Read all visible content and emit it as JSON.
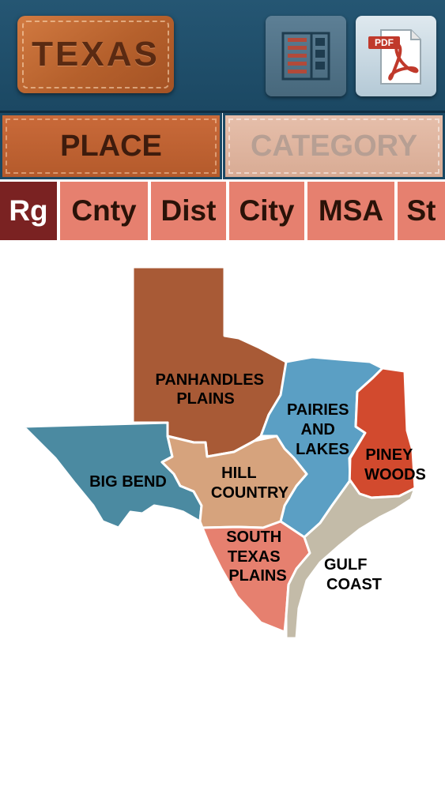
{
  "header": {
    "logo_text": "TEXAS",
    "table_icon": "table-list-icon",
    "pdf_icon": "pdf-document-icon",
    "pdf_label": "PDF"
  },
  "main_tabs": [
    {
      "label": "PLACE",
      "active": true
    },
    {
      "label": "CATEGORY",
      "active": false
    }
  ],
  "sub_tabs": [
    {
      "label": "Rg",
      "active": true
    },
    {
      "label": "Cnty",
      "active": false
    },
    {
      "label": "Dist",
      "active": false
    },
    {
      "label": "City",
      "active": false
    },
    {
      "label": "MSA",
      "active": false
    },
    {
      "label": "St",
      "active": false
    }
  ],
  "map": {
    "regions": [
      {
        "name": "panhandle-plains",
        "lines": [
          "PANHANDLES",
          "PLAINS"
        ],
        "color": "#a85a36"
      },
      {
        "name": "prairies-lakes",
        "lines": [
          "PAIRIES",
          "AND",
          "LAKES"
        ],
        "color": "#5b9fc4"
      },
      {
        "name": "piney-woods",
        "lines": [
          "PINEY",
          "WOODS"
        ],
        "color": "#d24a2e"
      },
      {
        "name": "big-bend",
        "lines": [
          "BIG BEND"
        ],
        "color": "#4b8aa1"
      },
      {
        "name": "hill-country",
        "lines": [
          "HILL",
          "COUNTRY"
        ],
        "color": "#d6a37d"
      },
      {
        "name": "south-texas-plains",
        "lines": [
          "SOUTH",
          "TEXAS",
          "PLAINS"
        ],
        "color": "#e6806f"
      },
      {
        "name": "gulf-coast",
        "lines": [
          "GULF",
          "COAST"
        ],
        "color": "#c3bba8"
      }
    ]
  }
}
